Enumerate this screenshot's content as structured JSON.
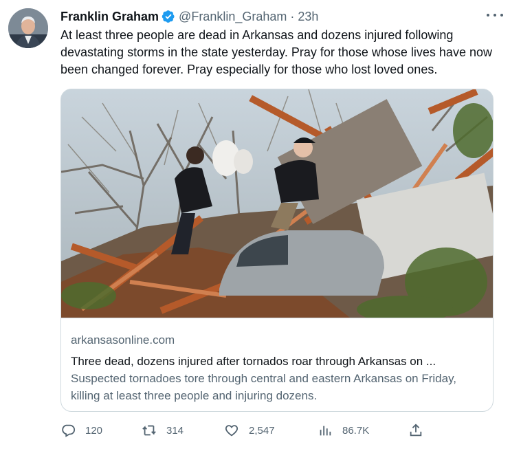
{
  "author": {
    "name": "Franklin Graham",
    "handle": "@Franklin_Graham",
    "separator": "·",
    "time": "23h"
  },
  "tweet": {
    "text": "At least three people are dead in Arkansas and dozens injured following devastating storms in the state yesterday. Pray for those whose lives have now been changed forever. Pray especially for those who lost loved ones."
  },
  "card": {
    "domain": "arkansasonline.com",
    "title": "Three dead, dozens injured after tornados roar through Arkansas on ...",
    "description": "Suspected tornadoes tore through central and eastern Arkansas on Friday, killing at least three people and injuring dozens."
  },
  "actions": {
    "replies": "120",
    "retweets": "314",
    "likes": "2,547",
    "views": "86.7K"
  },
  "icons": {
    "verified": "verified-badge-icon",
    "more": "more-icon",
    "reply": "reply-icon",
    "retweet": "retweet-icon",
    "like": "heart-icon",
    "views": "views-icon",
    "share": "share-icon"
  },
  "colors": {
    "text": "#0f1419",
    "secondary": "#536471",
    "verified": "#1d9bf0",
    "border": "#cfd9de"
  }
}
